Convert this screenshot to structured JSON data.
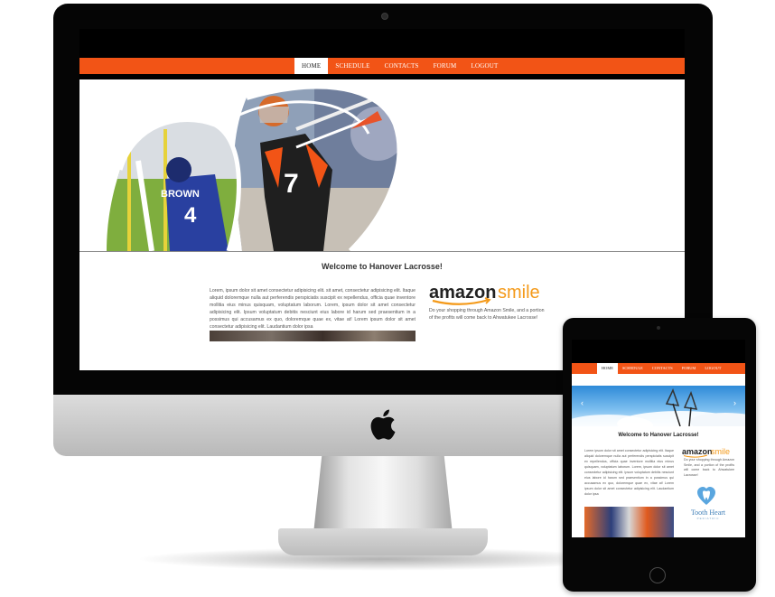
{
  "desktop": {
    "nav": [
      "Home",
      "Schedule",
      "Contacts",
      "Forum",
      "Logout"
    ],
    "active_nav": "Home",
    "welcome": "Welcome to Hanover Lacrosse!",
    "lorem": "Lorem, ipsum dolor sit amet consectetur adipisicing elit. sit amet, consectetur adipisicing elit. Itaque aliquid doloremque nulla aut perferendis perspiciatis suscipit ex repellendus, officia quae inventore mollitia eius minus quisquam, voluptatum laborum. Lorem, ipsum dolor sit amet consectetur adipisicing elit. Ipsum voluptatum debitis nesciunt eius labore id harum sed praesentium in a possimus qui accusamus ex quo, doloremque quae ex, vitae at! Lorem ipsum dolor sit amet consectetur adipisicing elit. Laudantium dolor ipsa",
    "amazon_word": "amazon",
    "amazon_smile": "smile",
    "amazon_note": "Do your shopping through Amazon Smile, and a portion of the profits will come back to Ahwatukee Lacrosse!",
    "hero_player_numbers": [
      "7",
      "4"
    ],
    "hero_player_name": "BROWN"
  },
  "tablet": {
    "nav": [
      "Home",
      "Schedule",
      "Contacts",
      "Forum",
      "Logout"
    ],
    "active_nav": "Home",
    "arrow_left": "‹",
    "arrow_right": "›",
    "welcome": "Welcome to Hanover Lacrosse!",
    "lorem": "Lorem ipsum dolor sit amet consectetur adipisicing elit. Itaque aliquid doloremque nulla aut perferendis perspiciatis suscipit ex repellendus, officia quae inventore mollitia eius minus quisquam, voluptatum laborum. Lorem, ipsum dolor sit amet consectetur adipisicing elit. Ipsum voluptatum debitis nesciunt eius labore id harum sed praesentium in a possimus qui accusamus ex quo, doloremque quae ex, vitae at! Lorem ipsum dolor sit amet consectetur adipisicing elit. Laudantium dolor ipsa",
    "amazon_word": "amazon",
    "amazon_smile": "smile",
    "amazon_note": "Do your shopping through Amazon Smile, and a portion of the profits will come back to Ahwatukee Lacrosse!",
    "sponsor_name": "Tooth Heart",
    "sponsor_sub": "PEDIATRIC"
  },
  "colors": {
    "brand_orange": "#f25416",
    "amazon_orange": "#f49a1a",
    "sponsor_blue": "#3f7fb8"
  }
}
